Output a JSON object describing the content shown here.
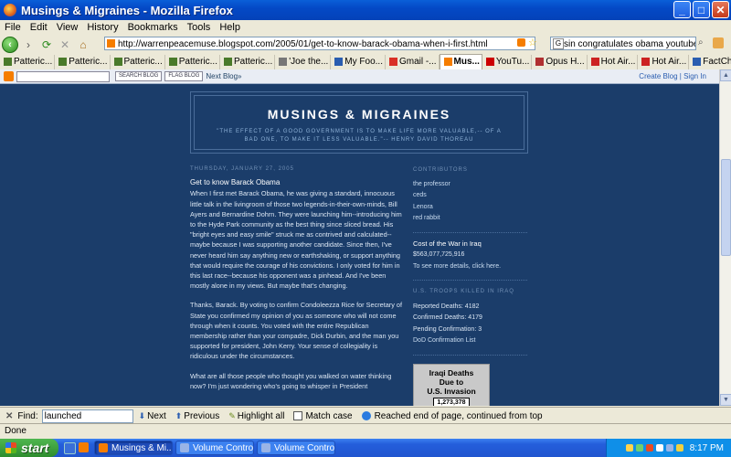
{
  "window": {
    "title": "Musings & Migraines - Mozilla Firefox"
  },
  "menu": [
    "File",
    "Edit",
    "View",
    "History",
    "Bookmarks",
    "Tools",
    "Help"
  ],
  "nav": {
    "url": "http://warrenpeacemuse.blogspot.com/2005/01/get-to-know-barack-obama-when-i-first.html",
    "search_value": "sin congratulates obama youtube"
  },
  "bookmarks": [
    {
      "label": "Patteric...",
      "color": "#4a7a2a"
    },
    {
      "label": "Patteric...",
      "color": "#4a7a2a"
    },
    {
      "label": "Patteric...",
      "color": "#4a7a2a"
    },
    {
      "label": "Patteric...",
      "color": "#4a7a2a"
    },
    {
      "label": "Patteric...",
      "color": "#4a7a2a"
    },
    {
      "label": "'Joe the...",
      "color": "#777777"
    },
    {
      "label": "My Foo...",
      "color": "#2a5db0"
    },
    {
      "label": "Gmail -...",
      "color": "#d93025"
    },
    {
      "label": "Mus...",
      "color": "#f57d00",
      "active": true
    },
    {
      "label": "YouTu...",
      "color": "#cc0000"
    },
    {
      "label": "Opus H...",
      "color": "#b03030"
    },
    {
      "label": "Hot Air...",
      "color": "#cc2222"
    },
    {
      "label": "Hot Air...",
      "color": "#cc2222"
    },
    {
      "label": "FactChe...",
      "color": "#2a5db0"
    }
  ],
  "blogger_bar": {
    "search_btn": "SEARCH BLOG",
    "flag_btn": "FLAG BLOG",
    "next_blog": "Next Blog»",
    "create_blog": "Create Blog",
    "sep": "|",
    "sign_in": "Sign In"
  },
  "blog": {
    "title": "MUSINGS & MIGRAINES",
    "description": "\"THE EFFECT OF A GOOD GOVERNMENT IS TO MAKE LIFE MORE VALUABLE,-- OF A BAD ONE, TO MAKE IT LESS VALUABLE.\"-- HENRY DAVID THOREAU"
  },
  "post": {
    "date": "THURSDAY, JANUARY 27, 2005",
    "title": "Get to know Barack Obama",
    "paragraphs": [
      "When I first met Barack Obama, he was giving a standard, innocuous little talk in the livingroom of those two legends-in-their-own-minds, Bill Ayers and Bernardine Dohrn. They were launching him--introducing him to the Hyde Park community as the best thing since sliced bread. His \"bright eyes and easy smile\" struck me as contrived and calculated--maybe because I was supporting another candidate. Since then, I've never heard him say anything new or earthshaking, or support anything that would require the courage of his convictions. I only voted for him in this last race--because his opponent was a pinhead. And I've been mostly alone in my views. But maybe that's changing.",
      "Thanks, Barack. By voting to confirm Condoleezza Rice for Secretary of State you confirmed my opinion of you as someone who will not come through when it counts. You voted with the entire Republican membership rather than your compadre, Dick Durbin, and the man you supported for president, John Kerry. Your sense of collegiality is ridiculous under the circumstances.",
      "What are all those people who thought you walked on water thinking now? I'm just wondering who's going to whisper in President"
    ]
  },
  "sidebar": {
    "contributors_heading": "CONTRIBUTORS",
    "contributors": [
      "the professor",
      "ceds",
      "Lenora",
      "red rabbit"
    ],
    "cost_title": "Cost of the War in Iraq",
    "cost_value": "$563,077,725,916",
    "cost_link": "To see more details, click here.",
    "troops_heading": "U.S. TROOPS KILLED IN IRAQ",
    "reported": "Reported Deaths: 4182",
    "confirmed": "Confirmed Deaths: 4179",
    "pending": "Pending Confirmation: 3",
    "dod_link": "DoD Confirmation List",
    "image_line1": "Iraqi Deaths",
    "image_line2": "Due to",
    "image_line3": "U.S. Invasion",
    "image_count": "1,273,378"
  },
  "findbar": {
    "label": "Find:",
    "value": "launched",
    "next": "Next",
    "previous": "Previous",
    "highlight": "Highlight all",
    "match_case": "Match case",
    "status": "Reached end of page, continued from top"
  },
  "status": {
    "text": "Done"
  },
  "taskbar": {
    "start": "start",
    "tasks": [
      {
        "label": "Musings & Mi...",
        "active": true,
        "color": "#f57d00"
      },
      {
        "label": "Volume Control",
        "active": false,
        "color": "#9ab4e6"
      },
      {
        "label": "Volume Control",
        "active": false,
        "color": "#9ab4e6"
      }
    ],
    "clock": "8:17 PM"
  }
}
